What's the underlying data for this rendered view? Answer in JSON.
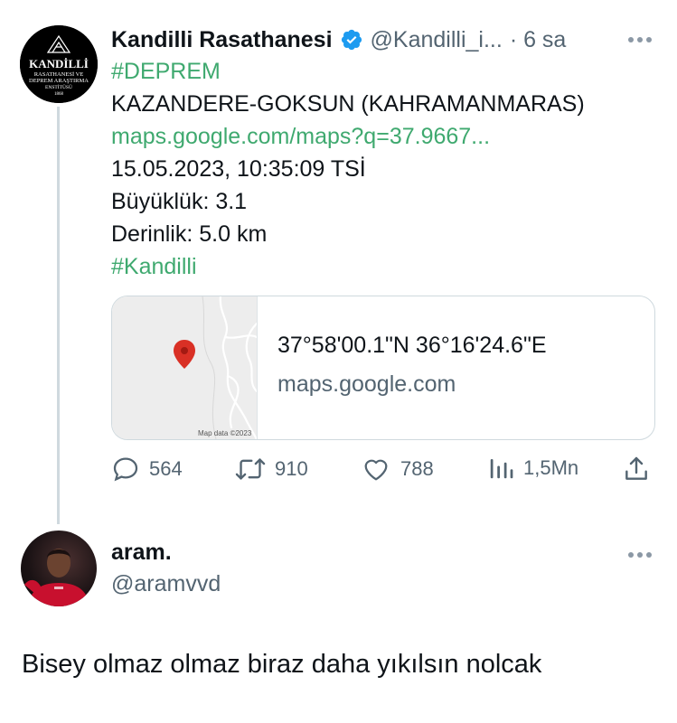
{
  "tweet": {
    "author_name": "Kandilli Rasathanesi",
    "verified": true,
    "author_handle": "@Kandilli_i...",
    "time": "· 6 sa",
    "avatar_text": "KANDİLLİ",
    "avatar_sub1": "RASATHANESİ VE",
    "avatar_sub2": "DEPREM ARAŞTIRMA",
    "avatar_sub3": "ENSTİTÜSÜ",
    "avatar_year": "1868",
    "lines": {
      "hashtag1": "#DEPREM",
      "location": "KAZANDERE-GOKSUN (KAHRAMANMARAS)",
      "link": "maps.google.com/maps?q=37.9667...",
      "datetime": "15.05.2023, 10:35:09 TSİ",
      "magnitude": "Büyüklük: 3.1",
      "depth": "Derinlik: 5.0 km",
      "hashtag2": "#Kandilli"
    },
    "card": {
      "coords": "37°58'00.1\"N 36°16'24.6\"E",
      "domain": "maps.google.com",
      "map_credit": "Map data ©2023"
    },
    "stats": {
      "replies": "564",
      "retweets": "910",
      "likes": "788",
      "views": "1,5Mn"
    }
  },
  "reply": {
    "author_name": "aram.",
    "author_handle": "@aramvvd",
    "text": "Bisey olmaz olmaz biraz daha yıkılsın nolcak"
  },
  "colors": {
    "link_green": "#3fa96f",
    "verified_blue": "#1d9bf0",
    "muted": "#536471",
    "map_pin": "#d93025"
  }
}
